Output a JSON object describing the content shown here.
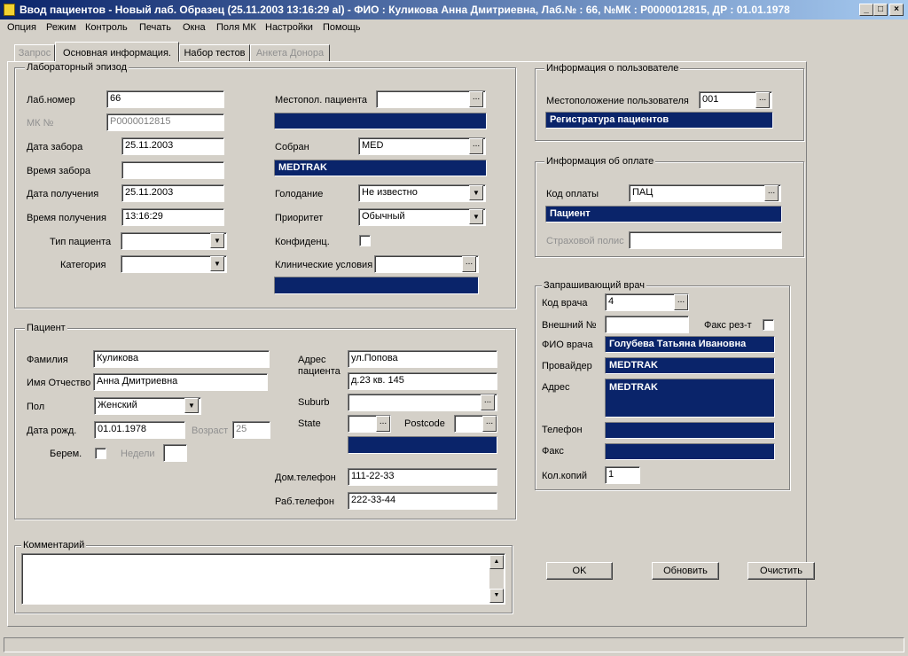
{
  "window": {
    "title": "Ввод пациентов - Новый лаб. Образец (25.11.2003 13:16:29 al)  - ФИО : Куликова Анна Дмитриевна, Лаб.№ : 66, №МК : P0000012815, ДР : 01.01.1978"
  },
  "menu": [
    "Опция",
    "Режим",
    "Контроль",
    "Печать",
    "Окна",
    "Поля МК",
    "Настройки",
    "Помощь"
  ],
  "tabs": [
    "Запрос",
    "Основная информация.",
    "Набор тестов",
    "Анкета Донора"
  ],
  "lab": {
    "legend": "Лабораторный эпизод",
    "lab_no_label": "Лаб.номер",
    "lab_no": "66",
    "mk_label": "МК №",
    "mk": "P0000012815",
    "collect_date_label": "Дата забора",
    "collect_date": "25.11.2003",
    "collect_time_label": "Время забора",
    "collect_time": "",
    "recv_date_label": "Дата получения",
    "recv_date": "25.11.2003",
    "recv_time_label": "Время получения",
    "recv_time": "13:16:29",
    "ptype_label": "Тип пациента",
    "ptype": "",
    "category_label": "Категория",
    "category": "",
    "location_label": "Местопол. пациента",
    "location": "",
    "location_desc": "",
    "collected_label": "Собран",
    "collected": "MED",
    "collected_desc": "MEDTRAK",
    "fasting_label": "Голодание",
    "fasting": "Не известно",
    "priority_label": "Приоритет",
    "priority": "Обычный",
    "confidential_label": "Конфиденц.",
    "clinical_label": "Клинические условия",
    "clinical": "",
    "clinical_desc": ""
  },
  "patient": {
    "legend": "Пациент",
    "surname_label": "Фамилия",
    "surname": "Куликова",
    "name_label": "Имя Отчество",
    "name": "Анна Дмитриевна",
    "sex_label": "Пол",
    "sex": "Женский",
    "dob_label": "Дата рожд.",
    "dob": "01.01.1978",
    "age_label": "Возраст",
    "age": "25",
    "pregnant_label": "Берем.",
    "weeks_label": "Недели",
    "weeks": "",
    "address_label": "Адрес пациента",
    "address1": "ул.Попова",
    "address2": "д.23 кв. 145",
    "suburb_label": "Suburb",
    "suburb": "",
    "state_label": "State",
    "state": "",
    "postcode_label": "Postcode",
    "postcode": "",
    "state_desc": "",
    "home_phone_label": "Дом.телефон",
    "home_phone": "111-22-33",
    "work_phone_label": "Раб.телефон",
    "work_phone": "222-33-44"
  },
  "comment": {
    "legend": "Комментарий",
    "text": ""
  },
  "user_info": {
    "legend": "Информация о пользователе",
    "location_label": "Местоположение пользователя",
    "location": "001",
    "location_desc": "Регистратура пациентов"
  },
  "payment": {
    "legend": "Информация об оплате",
    "code_label": "Код оплаты",
    "code": "ПАЦ",
    "code_desc": "Пациент",
    "policy_label": "Страховой полис",
    "policy": ""
  },
  "doctor": {
    "legend": "Запрашивающий врач",
    "code_label": "Код врача",
    "code": "4",
    "ext_label": "Внешний №",
    "ext": "",
    "fax_result_label": "Факс рез-т",
    "name_label": "ФИО врача",
    "name": "Голубева Татьяна Ивановна",
    "provider_label": "Провайдер",
    "provider": "MEDTRAK",
    "address_label": "Адрес",
    "address": "MEDTRAK",
    "phone_label": "Телефон",
    "phone": "",
    "fax_label": "Факс",
    "fax": "",
    "copies_label": "Кол.копий",
    "copies": "1"
  },
  "buttons": {
    "ok": "OK",
    "refresh": "Обновить",
    "clear": "Очистить"
  },
  "colors": {
    "title_bar": "#0a246a",
    "desc_field": "#0a246a",
    "face": "#d4d0c8"
  }
}
